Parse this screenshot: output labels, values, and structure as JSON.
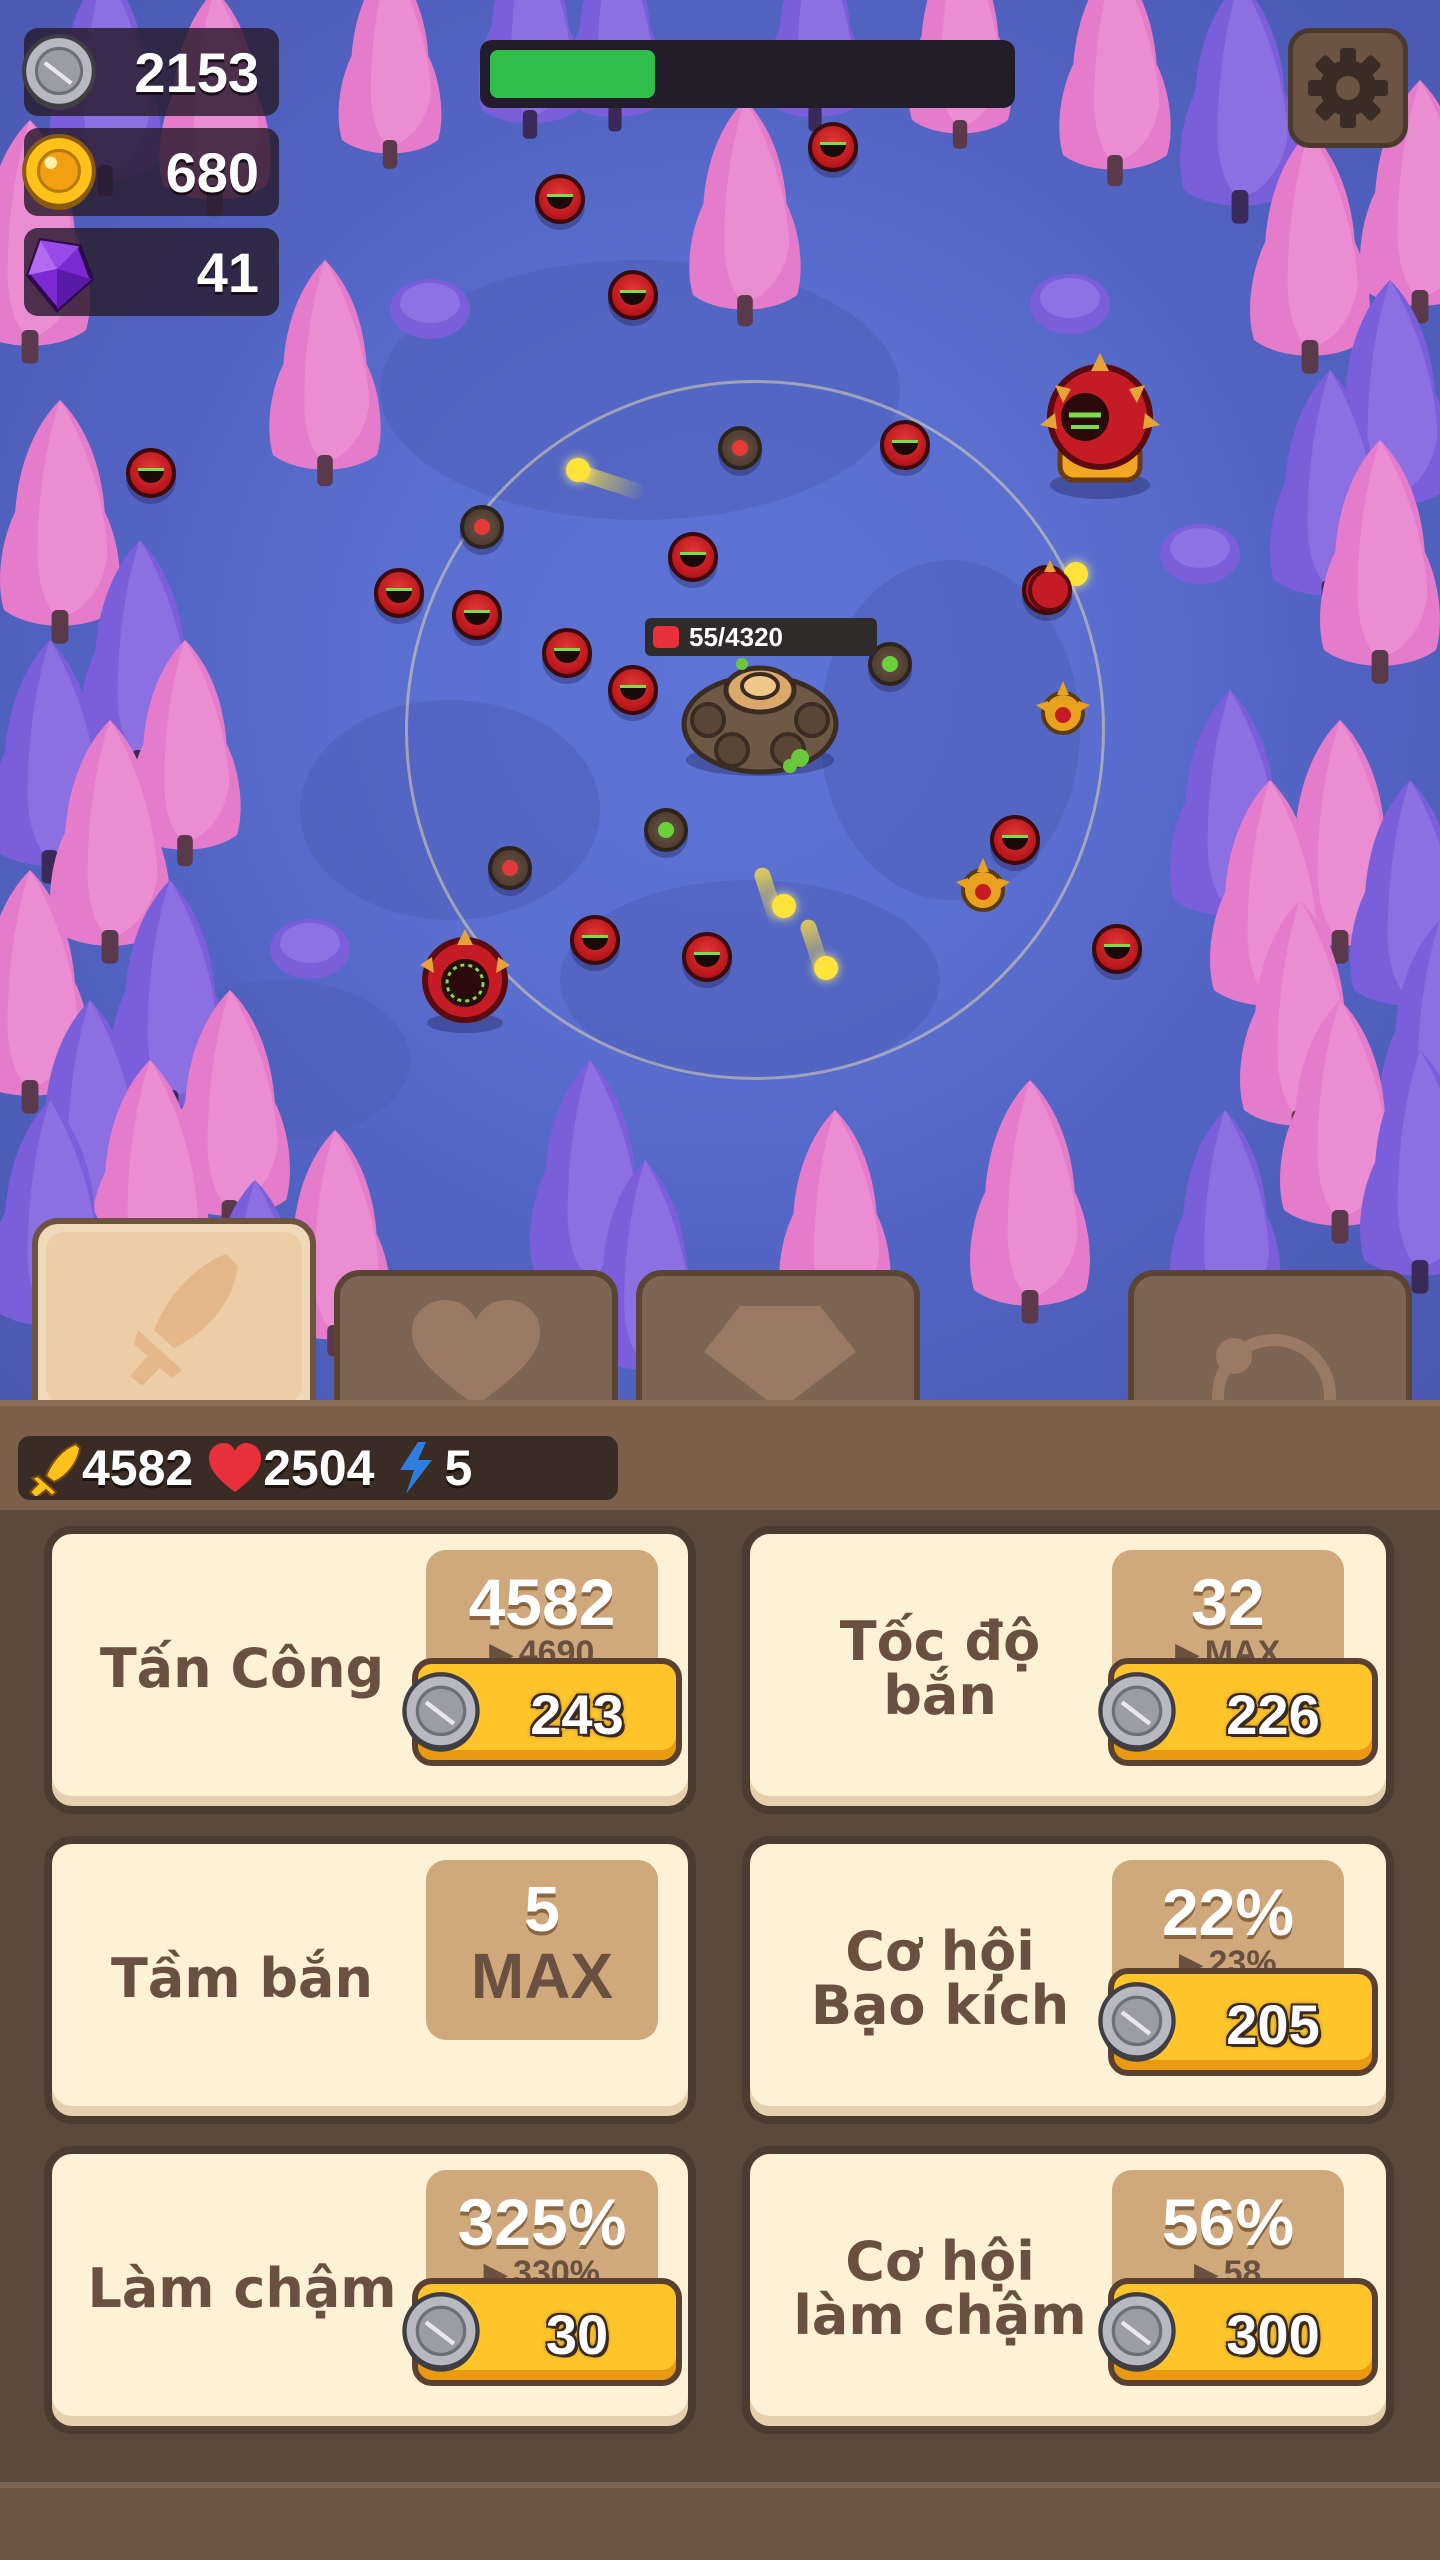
{
  "hud": {
    "silver_coins": "2153",
    "gold_coins": "680",
    "gems": "41",
    "wave_progress": 0.32
  },
  "turret": {
    "hp_text": "55/4320"
  },
  "stats": {
    "attack": "4582",
    "health": "2504",
    "energy": "5"
  },
  "tabs": [
    {
      "name": "attack",
      "icon": "sword-icon",
      "active": true
    },
    {
      "name": "defense",
      "icon": "heart-icon",
      "active": false
    },
    {
      "name": "gem",
      "icon": "diamond-icon",
      "active": false
    },
    {
      "name": "misc",
      "icon": "orbit-icon",
      "active": false
    }
  ],
  "upgrades": {
    "attack": {
      "label": "Tấn Công",
      "current": "4582",
      "next": "4690",
      "cost": "243"
    },
    "fire_rate": {
      "label_line1": "Tốc độ",
      "label_line2": "bắn",
      "current": "32",
      "next": "MAX",
      "cost": "226"
    },
    "range": {
      "label": "Tầm bắn",
      "current": "5",
      "max": "MAX"
    },
    "crit_chance": {
      "label_line1": "Cơ hội",
      "label_line2": "Bạo kích",
      "current": "22%",
      "next": "23%",
      "cost": "205"
    },
    "slow": {
      "label": "Làm chậm",
      "current": "325%",
      "next": "330%",
      "cost": "30"
    },
    "slow_chance": {
      "label_line1": "Cơ hội",
      "label_line2": "làm chậm",
      "current": "56%",
      "next": "58",
      "cost": "300"
    }
  },
  "colors": {
    "ground": "#5a6fd0",
    "tree_pink": "#e07ac6",
    "tree_purple": "#7a5ad8",
    "panel": "#5b4a3c",
    "card": "#fdf1d6",
    "buy_button": "#ffc52b",
    "progress": "#2fbf4a"
  }
}
